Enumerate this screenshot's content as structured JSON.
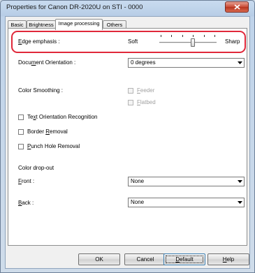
{
  "window": {
    "title": "Properties for Canon DR-2020U on STI - 0000"
  },
  "tabs": [
    {
      "label": "Basic"
    },
    {
      "label": "Brightness"
    },
    {
      "label": "Image processing"
    },
    {
      "label": "Others"
    }
  ],
  "edge_emphasis": {
    "label_mnemonic": "E",
    "label_rest": "dge emphasis :",
    "min_label": "Soft",
    "max_label": "Sharp",
    "position_steps": 3,
    "max_steps": 5
  },
  "orientation": {
    "label_pre": "Docu",
    "label_mnemonic": "m",
    "label_rest": "ent Orientation :",
    "value": "0 degrees"
  },
  "color_smoothing": {
    "label": "Color Smoothing :",
    "feeder_mnemonic": "F",
    "feeder_rest": "eeder",
    "flatbed_mnemonic": "F",
    "flatbed_rest": "latbed"
  },
  "checks": {
    "text_orientation_pre": "Te",
    "text_orientation_mnemonic": "x",
    "text_orientation_rest": "t Orientation Recognition",
    "border_pre": "Border ",
    "border_mnemonic": "R",
    "border_rest": "emoval",
    "punch_mnemonic": "P",
    "punch_rest": "unch Hole Removal"
  },
  "dropout": {
    "heading": "Color drop-out",
    "front_mnemonic": "F",
    "front_rest": "ront :",
    "front_value": "None",
    "back_mnemonic": "B",
    "back_rest": "ack :",
    "back_value": "None"
  },
  "buttons": {
    "ok": "OK",
    "cancel": "Cancel",
    "default_mnemonic": "D",
    "default_rest": "efault",
    "help_mnemonic": "H",
    "help_rest": "elp"
  },
  "colors": {
    "highlight": "#e0283a",
    "close_button": "#c94b36"
  },
  "icons": [
    "close-icon",
    "dropdown-arrow-icon"
  ]
}
